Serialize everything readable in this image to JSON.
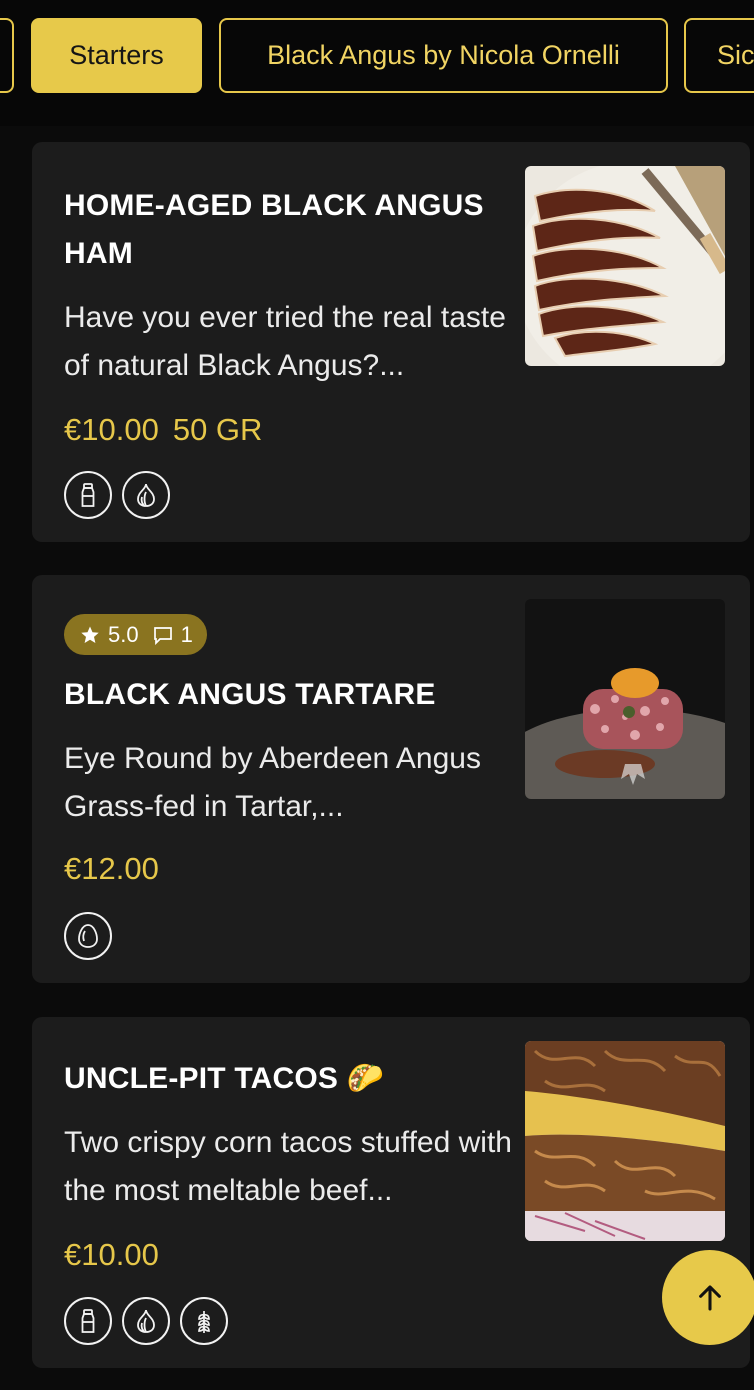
{
  "tabs": [
    {
      "label": "",
      "active": false
    },
    {
      "label": "Starters",
      "active": true
    },
    {
      "label": "Black Angus by Nicola Ornelli",
      "active": false
    },
    {
      "label": "Sic",
      "active": false
    }
  ],
  "items": [
    {
      "title": "HOME-AGED BLACK ANGUS HAM",
      "description": "Have you ever tried the real taste of natural Black Angus?...",
      "price": "€10.00",
      "weight": "50 GR",
      "allergens": [
        "bottle-icon",
        "garlic-icon"
      ]
    },
    {
      "rating": "5.0",
      "reviews": "1",
      "title": "BLACK ANGUS TARTARE",
      "description": "Eye Round by Aberdeen Angus Grass-fed in Tartar,...",
      "price": "€12.00",
      "allergens": [
        "egg-icon"
      ]
    },
    {
      "title": "UNCLE-PIT TACOS 🌮",
      "description": "Two crispy corn tacos stuffed with the most meltable beef...",
      "price": "€10.00",
      "allergens": [
        "bottle-icon",
        "garlic-icon",
        "wheat-icon"
      ]
    }
  ],
  "colors": {
    "accent": "#e7c94a",
    "card_bg": "#1c1c1c",
    "page_bg": "#0b0b0b",
    "rating_bg": "#8a7420"
  },
  "scroll_top_icon": "arrow-up-icon"
}
